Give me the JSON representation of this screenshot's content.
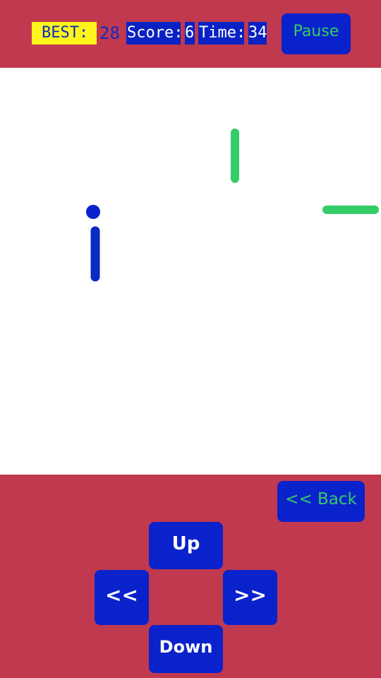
{
  "hud": {
    "best_label": "BEST:",
    "best_value": "28",
    "score_label": "Score:",
    "score_value": "6",
    "time_label": "Time:",
    "time_value": "34"
  },
  "buttons": {
    "pause": "Pause",
    "back": "<< Back",
    "up": "Up",
    "left": "<<",
    "right": ">>",
    "down": "Down"
  },
  "colors": {
    "background": "#c0394e",
    "playfield": "#ffffff",
    "button": "#0a22cc",
    "player": "#0a22cc",
    "enemy": "#33cc66",
    "best_highlight": "#fff51a"
  }
}
